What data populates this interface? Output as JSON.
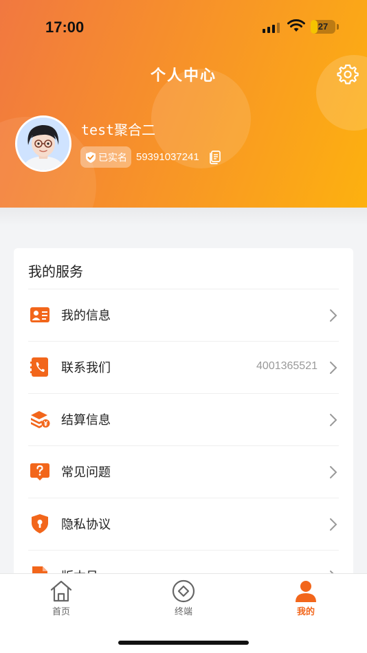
{
  "status_bar": {
    "time": "17:00",
    "battery": "27",
    "battery_level": 0.27
  },
  "header": {
    "title": "个人中心",
    "settings_icon": "gear-icon"
  },
  "profile": {
    "username": "test聚合二",
    "verified_label": "已实名",
    "user_id": "59391037241"
  },
  "services": {
    "title": "我的服务",
    "items": [
      {
        "label": "我的信息",
        "icon": "id-card-icon",
        "value": ""
      },
      {
        "label": "联系我们",
        "icon": "phone-icon",
        "value": "4001365521"
      },
      {
        "label": "结算信息",
        "icon": "settlement-icon",
        "value": ""
      },
      {
        "label": "常见问题",
        "icon": "question-icon",
        "value": ""
      },
      {
        "label": "隐私协议",
        "icon": "shield-lock-icon",
        "value": ""
      },
      {
        "label": "版本号",
        "icon": "document-icon",
        "value": ""
      }
    ]
  },
  "tabbar": {
    "tabs": [
      {
        "label": "首页",
        "icon": "home-icon"
      },
      {
        "label": "终端",
        "icon": "terminal-icon"
      },
      {
        "label": "我的",
        "icon": "person-icon",
        "active": true
      }
    ]
  },
  "colors": {
    "accent": "#F2661B",
    "gradient_start": "#F17840",
    "gradient_end": "#FDB10F"
  }
}
